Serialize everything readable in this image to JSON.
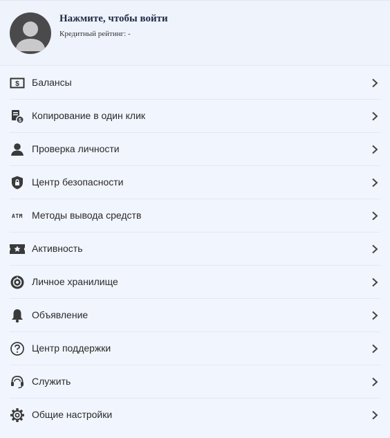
{
  "header": {
    "login_title": "Нажмите, чтобы войти",
    "credit_label": "Кредитный рейтинг:",
    "credit_value": "-"
  },
  "menu": {
    "items": [
      {
        "label": "Балансы",
        "icon": "balance-icon"
      },
      {
        "label": "Копирование в один клик",
        "icon": "copy-trade-icon"
      },
      {
        "label": "Проверка личности",
        "icon": "user-icon"
      },
      {
        "label": "Центр безопасности",
        "icon": "shield-icon"
      },
      {
        "label": "Методы вывода средств",
        "icon": "atm-icon",
        "icon_text": "ATM"
      },
      {
        "label": "Активность",
        "icon": "ticket-star-icon"
      },
      {
        "label": "Личное хранилище",
        "icon": "vault-icon"
      },
      {
        "label": "Объявление",
        "icon": "bell-icon"
      },
      {
        "label": "Центр поддержки",
        "icon": "help-icon"
      },
      {
        "label": "Служить",
        "icon": "headset-icon"
      },
      {
        "label": "Общие настройки",
        "icon": "gear-icon"
      }
    ]
  },
  "colors": {
    "background": "#f1f5fd",
    "icon": "#3a3a3a",
    "avatar": "#4a4a4d"
  }
}
